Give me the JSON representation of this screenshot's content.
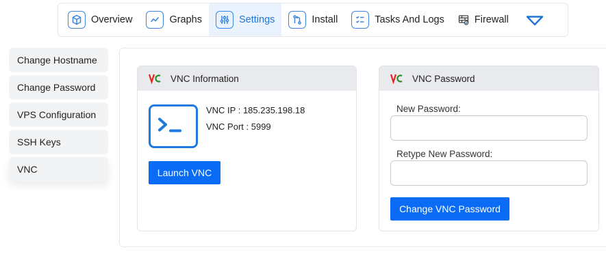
{
  "nav": {
    "items": [
      {
        "label": "Overview",
        "icon": "cube-icon"
      },
      {
        "label": "Graphs",
        "icon": "graph-icon"
      },
      {
        "label": "Settings",
        "icon": "sliders-icon",
        "active": true
      },
      {
        "label": "Install",
        "icon": "git-icon"
      },
      {
        "label": "Tasks And Logs",
        "icon": "checklist-icon"
      },
      {
        "label": "Firewall",
        "icon": "firewall-icon"
      }
    ],
    "more_icon": "chevron-down-icon"
  },
  "sidebar": {
    "items": [
      {
        "label": "Change Hostname"
      },
      {
        "label": "Change Password"
      },
      {
        "label": "VPS Configuration"
      },
      {
        "label": "SSH Keys"
      },
      {
        "label": "VNC",
        "active": true
      }
    ]
  },
  "vnc_info": {
    "title": "VNC Information",
    "ip_line": "VNC IP : 185.235.198.18",
    "port_line": "VNC Port : 5999",
    "launch_label": "Launch VNC"
  },
  "vnc_password": {
    "title": "VNC Password",
    "new_label": "New Password:",
    "new_value": "",
    "retype_label": "Retype New Password:",
    "retype_value": "",
    "button_label": "Change VNC Password"
  },
  "colors": {
    "accent": "#0a6cf5",
    "nav_active_bg": "#eaf3fd",
    "icon_blue": "#3a86e0"
  }
}
